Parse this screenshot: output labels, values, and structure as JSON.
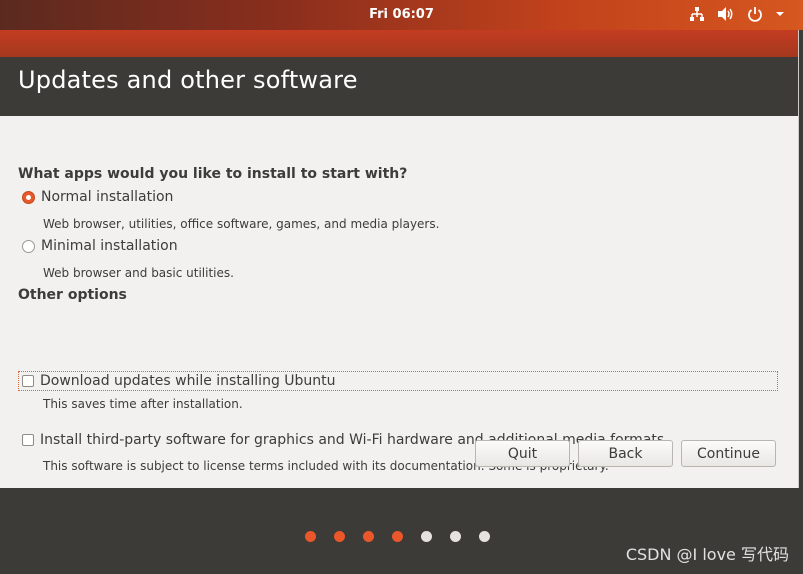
{
  "top_panel": {
    "clock": "Fri 06:07",
    "tray_icons": [
      "network-icon",
      "volume-icon",
      "power-icon",
      "chevron-down-icon"
    ]
  },
  "window": {
    "title": "Updates and other software",
    "apps_question": "What apps would you like to install to start with?",
    "normal_install": {
      "label": "Normal installation",
      "description": "Web browser, utilities, office software, games, and media players.",
      "selected": true
    },
    "minimal_install": {
      "label": "Minimal installation",
      "description": "Web browser and basic utilities.",
      "selected": false
    },
    "other_options_heading": "Other options",
    "download_updates": {
      "label": "Download updates while installing Ubuntu",
      "description": "This saves time after installation.",
      "checked": false
    },
    "third_party": {
      "label": "Install third-party software for graphics and Wi-Fi hardware and additional media formats",
      "description": "This software is subject to license terms included with its documentation. Some is proprietary.",
      "checked": false
    },
    "buttons": {
      "quit": "Quit",
      "back": "Back",
      "continue": "Continue"
    }
  },
  "progress": {
    "total_steps": 7,
    "completed_steps": 4,
    "active_color": "#e9572a",
    "inactive_color": "#e6e3df"
  },
  "watermark": "CSDN @I love 写代码",
  "colors": {
    "accent": "#e9572a",
    "header_bg": "#3c3b37",
    "window_bg": "#f2f1f0"
  }
}
